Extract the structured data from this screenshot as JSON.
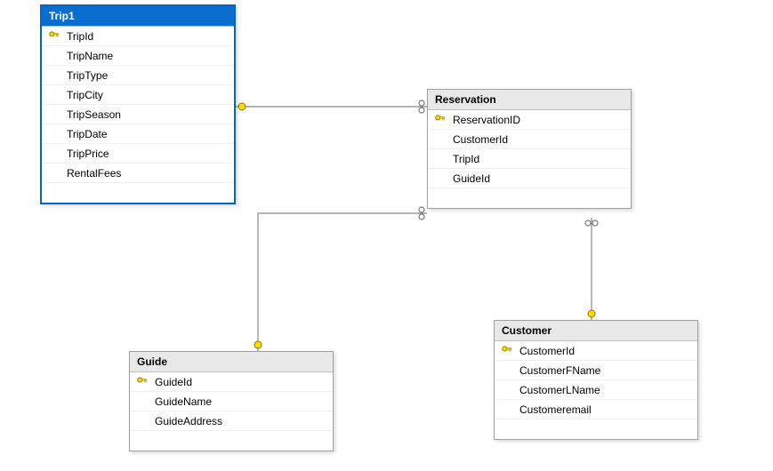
{
  "tables": {
    "trip": {
      "title": "Trip1",
      "fields": [
        "TripId",
        "TripName",
        "TripType",
        "TripCity",
        "TripSeason",
        "TripDate",
        "TripPrice",
        "RentalFees"
      ],
      "pk_index": 0
    },
    "reservation": {
      "title": "Reservation",
      "fields": [
        "ReservationID",
        "CustomerId",
        "TripId",
        "GuideId"
      ],
      "pk_index": 0
    },
    "guide": {
      "title": "Guide",
      "fields": [
        "GuideId",
        "GuideName",
        "GuideAddress"
      ],
      "pk_index": 0
    },
    "customer": {
      "title": "Customer",
      "fields": [
        "CustomerId",
        "CustomerFName",
        "CustomerLName",
        "Customeremail"
      ],
      "pk_index": 0
    }
  }
}
